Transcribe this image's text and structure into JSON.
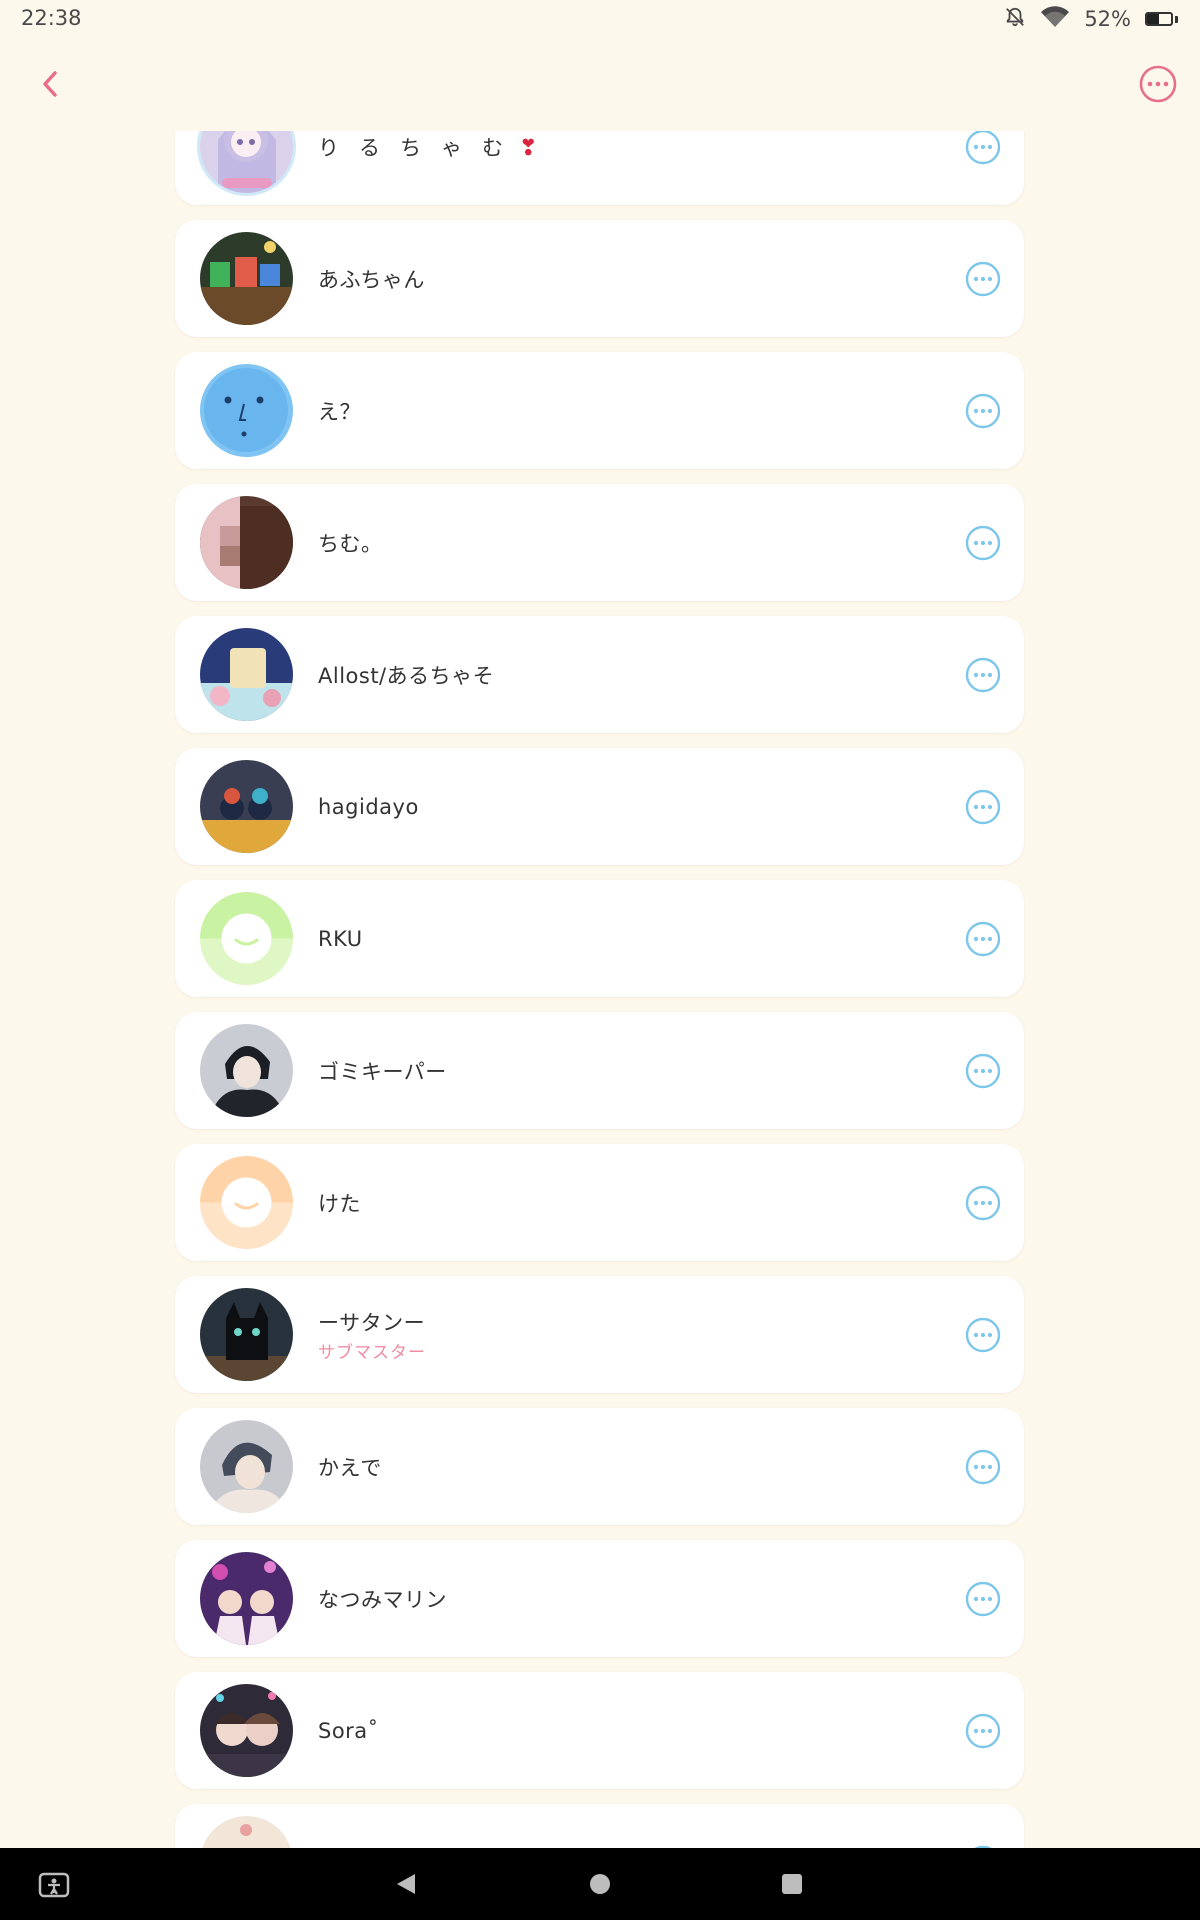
{
  "status_bar": {
    "time": "22:38",
    "battery_percent": "52%",
    "battery_level": 0.52,
    "icons": [
      "bell-off-icon",
      "wifi-icon",
      "battery-icon"
    ]
  },
  "header": {
    "back_icon": "chevron-left-icon",
    "more_icon": "more-horizontal-circle-icon"
  },
  "colors": {
    "background": "#fdf8ec",
    "card": "#ffffff",
    "accent_pink": "#e86f8b",
    "accent_blue": "#7cc6ea",
    "role_pink": "#f08ca3"
  },
  "members": [
    {
      "name": "りるちゃむ",
      "heart": "❣",
      "role": "",
      "avatar": "anime-girl-avatar"
    },
    {
      "name": "あふちゃん",
      "role": "",
      "avatar": "game-scene-avatar"
    },
    {
      "name": "え？",
      "role": "",
      "avatar": "blue-face-avatar"
    },
    {
      "name": "ちむ。",
      "role": "",
      "avatar": "photo-avatar"
    },
    {
      "name": "Allost/あるちゃそ",
      "role": "",
      "avatar": "illustration-avatar"
    },
    {
      "name": "hagidayo",
      "role": "",
      "avatar": "game-characters-avatar"
    },
    {
      "name": "RKU",
      "role": "",
      "avatar": "default-green-avatar"
    },
    {
      "name": "ゴミキーパー",
      "role": "",
      "avatar": "anime-boy-avatar"
    },
    {
      "name": "けた",
      "role": "",
      "avatar": "default-orange-avatar"
    },
    {
      "name": "ーサタンー",
      "role": "サブマスター",
      "avatar": "black-cat-avatar"
    },
    {
      "name": "かえで",
      "role": "",
      "avatar": "anime-boy-hoodie-avatar"
    },
    {
      "name": "なつみマリン",
      "role": "",
      "avatar": "stage-photo-avatar"
    },
    {
      "name": "Sora˚",
      "role": "",
      "avatar": "selfie-photo-avatar"
    },
    {
      "name": "",
      "role": "",
      "avatar": "partial-avatar"
    }
  ],
  "nav_bar": {
    "icons": [
      "accessibility-icon",
      "back-triangle-icon",
      "home-circle-icon",
      "recents-square-icon"
    ]
  }
}
